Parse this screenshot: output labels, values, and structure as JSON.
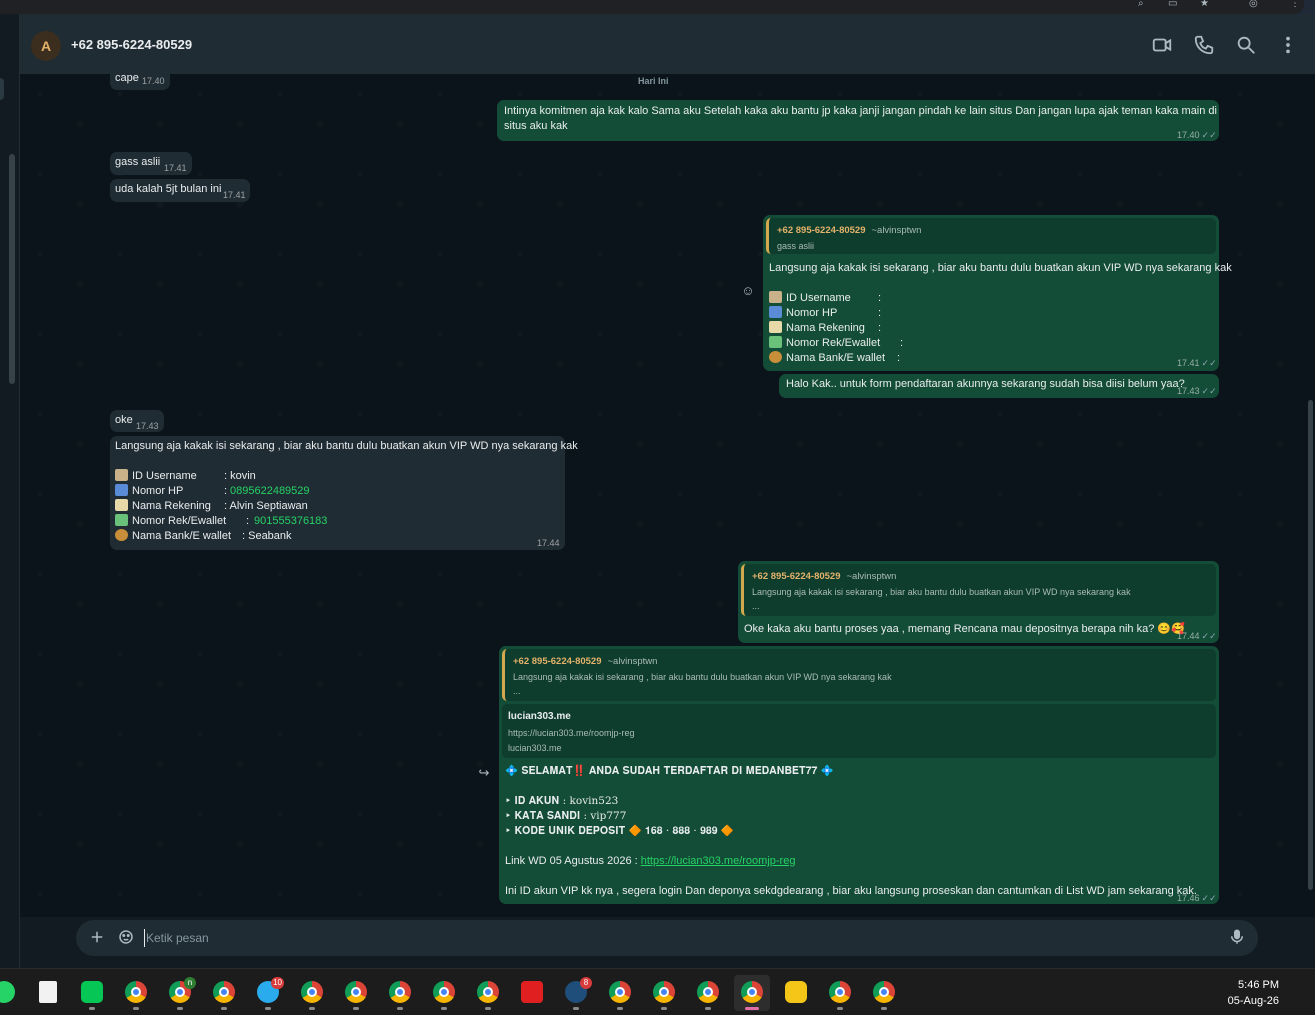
{
  "header": {
    "avatar_letter": "A",
    "contact_name": "+62 895-6224-80529"
  },
  "day_chip": "Hari Ini",
  "messages": {
    "m1": {
      "text": "cape",
      "time": "17.40"
    },
    "m2": {
      "line1": "Intinya komitmen aja kak kalo Sama aku Setelah kaka aku bantu jp kaka janji jangan pindah ke lain situs Dan jangan lupa ajak teman kaka main di",
      "line2": "situs aku kak",
      "time": "17.40"
    },
    "m3": {
      "text": "gass aslii",
      "time": "17.41"
    },
    "m4": {
      "text": "uda kalah 5jt bulan ini",
      "time": "17.41"
    },
    "m5": {
      "quote_name": "+62 895-6224-80529",
      "quote_alias": "~alvinsptwn",
      "quote_text": "gass aslii",
      "text": "Langsung aja kakak isi sekarang , biar aku bantu dulu buatkan akun VIP WD nya sekarang kak",
      "fields": [
        {
          "label": "ID Username",
          "sep": ":"
        },
        {
          "label": "Nomor HP",
          "sep": ":"
        },
        {
          "label": "Nama Rekening",
          "sep": ":"
        },
        {
          "label": "Nomor Rek/Ewallet",
          "sep": ":"
        },
        {
          "label": "Nama Bank/E wallet",
          "sep": ":"
        }
      ],
      "time": "17.41"
    },
    "m6": {
      "text": "Halo Kak.. untuk form pendaftaran akunnya sekarang sudah bisa diisi belum yaa?",
      "time": "17.43"
    },
    "m7": {
      "text": "oke",
      "time": "17.43"
    },
    "m8": {
      "text": "Langsung aja kakak isi sekarang , biar aku bantu dulu buatkan akun VIP WD nya sekarang kak",
      "fields": [
        {
          "label": "ID Username",
          "value": ": kovin"
        },
        {
          "label": "Nomor HP",
          "sep": ":",
          "value": "0895622489529"
        },
        {
          "label": "Nama Rekening",
          "value": ": Alvin Septiawan"
        },
        {
          "label": "Nomor Rek/Ewallet",
          "sep": ":",
          "value": "901555376183"
        },
        {
          "label": "Nama Bank/E wallet",
          "value": ": Seabank"
        }
      ],
      "time": "17.44"
    },
    "m9": {
      "quote_name": "+62 895-6224-80529",
      "quote_alias": "~alvinsptwn",
      "quote_text": "Langsung aja kakak isi sekarang , biar aku bantu dulu buatkan akun VIP WD nya sekarang kak",
      "quote_more": "...",
      "text": "Oke kaka aku bantu proses yaa , memang  Rencana mau depositnya berapa nih ka? 😊🥰",
      "time": "17.44"
    },
    "m10": {
      "quote_name": "+62 895-6224-80529",
      "quote_alias": "~alvinsptwn",
      "quote_text": "Langsung aja kakak isi sekarang , biar aku bantu dulu buatkan akun VIP WD nya sekarang kak",
      "quote_more": "...",
      "link_title": "lucian303.me",
      "link_url": "https://lucian303.me/roomjp-reg",
      "link_domain": "lucian303.me",
      "headline": "💠 𝐒𝐄𝐋𝐀𝐌𝐀𝐓‼️ 𝐀𝐍𝐃𝐀 𝐒𝐔𝐃𝐀𝐇 𝐓𝐄𝐑𝐃𝐀𝐅𝐓𝐀𝐑 𝐃𝐈 𝐌𝐄𝐃𝐀𝐍𝐁𝐄𝐓𝟕𝟕 💠",
      "id_line": "‣ 𝐈𝐃 𝐀𝐊𝐔𝐍 : kovin523",
      "pass_line": "‣ 𝐊𝐀𝐓𝐀 𝐒𝐀𝐍𝐃𝐈 : vip777",
      "code_line": "‣ 𝐊𝐎𝐃𝐄 𝐔𝐍𝐈𝐊 𝐃𝐄𝐏𝐎𝐒𝐈𝐓 🔶 𝟏𝟔𝟖 · 𝟖𝟖𝟖 · 𝟗𝟖𝟗 🔶",
      "wd_label": "Link WD 05 Agustus 2026 : ",
      "wd_link": "https://lucian303.me/roomjp-reg",
      "final": "Ini ID akun VIP kk nya , segera login Dan deponya sekdgdearang , biar aku langsung  proseskan dan cantumkan di List WD jam sekarang kak.",
      "time": "17.46"
    }
  },
  "composer": {
    "placeholder": "Ketik pesan"
  },
  "taskbar": {
    "badges": {
      "chrome2": "n",
      "telegram": "10",
      "app15": "8"
    },
    "time": "5:46 PM",
    "date": "05-Aug-26"
  },
  "colors": {
    "accent": "#25d366",
    "bubble_out": "#144d37",
    "bubble_in": "#202c33",
    "quote_name": "#e3b26a"
  }
}
